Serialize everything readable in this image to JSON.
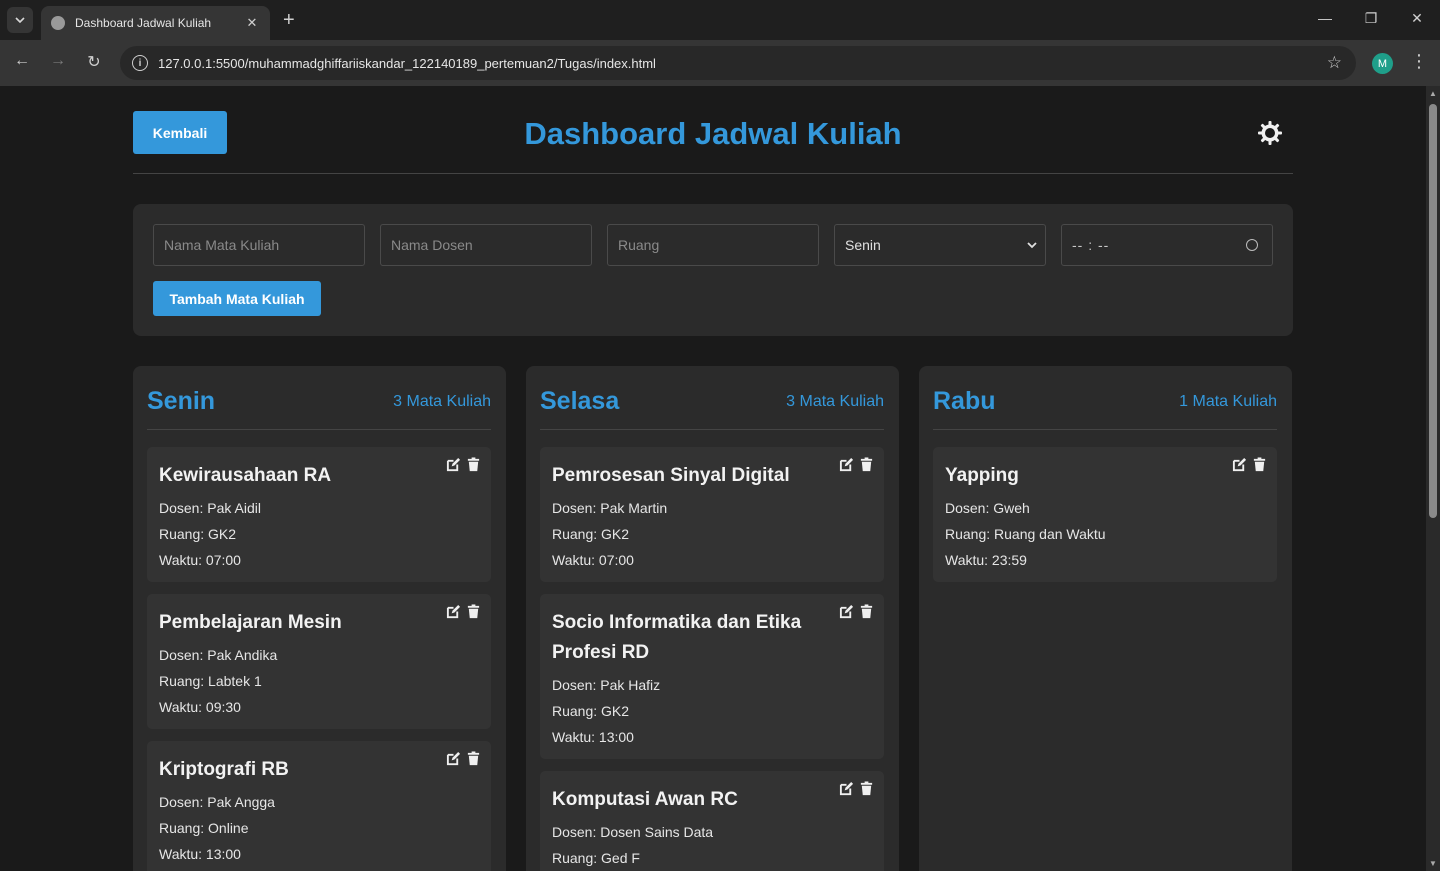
{
  "browser": {
    "tab_title": "Dashboard Jadwal Kuliah",
    "url": "127.0.0.1:5500/muhammadghiffariiskandar_122140189_pertemuan2/Tugas/index.html",
    "profile_initial": "M",
    "icons": [
      "tab-search-icon",
      "globe-icon",
      "close-icon",
      "new-tab-icon",
      "minimize-icon",
      "restore-icon",
      "window-close-icon",
      "back-arrow-icon",
      "forward-arrow-icon",
      "reload-icon",
      "site-info-icon",
      "bookmark-star-icon",
      "menu-kebab-icon"
    ]
  },
  "header": {
    "back_label": "Kembali",
    "title": "Dashboard Jadwal Kuliah",
    "theme_icon": "sun-icon"
  },
  "form": {
    "course_placeholder": "Nama Mata Kuliah",
    "lecturer_placeholder": "Nama Dosen",
    "room_placeholder": "Ruang",
    "day_selected": "Senin",
    "time_value": "-- : --",
    "add_label": "Tambah Mata Kuliah"
  },
  "colors": {
    "accent": "#3498db",
    "background": "#1a1a1a",
    "card": "#2b2b2b",
    "item": "#333333"
  },
  "days": [
    {
      "name": "Senin",
      "count": "3 Mata Kuliah",
      "courses": [
        {
          "title": "Kewirausahaan RA",
          "dosen": "Dosen: Pak Aidil",
          "ruang": "Ruang: GK2",
          "waktu": "Waktu: 07:00"
        },
        {
          "title": "Pembelajaran Mesin",
          "dosen": "Dosen: Pak Andika",
          "ruang": "Ruang: Labtek 1",
          "waktu": "Waktu: 09:30"
        },
        {
          "title": "Kriptografi RB",
          "dosen": "Dosen: Pak Angga",
          "ruang": "Ruang: Online",
          "waktu": "Waktu: 13:00"
        }
      ]
    },
    {
      "name": "Selasa",
      "count": "3 Mata Kuliah",
      "courses": [
        {
          "title": "Pemrosesan Sinyal Digital",
          "dosen": "Dosen: Pak Martin",
          "ruang": "Ruang: GK2",
          "waktu": "Waktu: 07:00"
        },
        {
          "title": "Socio Informatika dan Etika Profesi RD",
          "dosen": "Dosen: Pak Hafiz",
          "ruang": "Ruang: GK2",
          "waktu": "Waktu: 13:00"
        },
        {
          "title": "Komputasi Awan RC",
          "dosen": "Dosen: Dosen Sains Data",
          "ruang": "Ruang: Ged F",
          "waktu": ""
        }
      ]
    },
    {
      "name": "Rabu",
      "count": "1 Mata Kuliah",
      "courses": [
        {
          "title": "Yapping",
          "dosen": "Dosen: Gweh",
          "ruang": "Ruang: Ruang dan Waktu",
          "waktu": "Waktu: 23:59"
        }
      ]
    }
  ]
}
